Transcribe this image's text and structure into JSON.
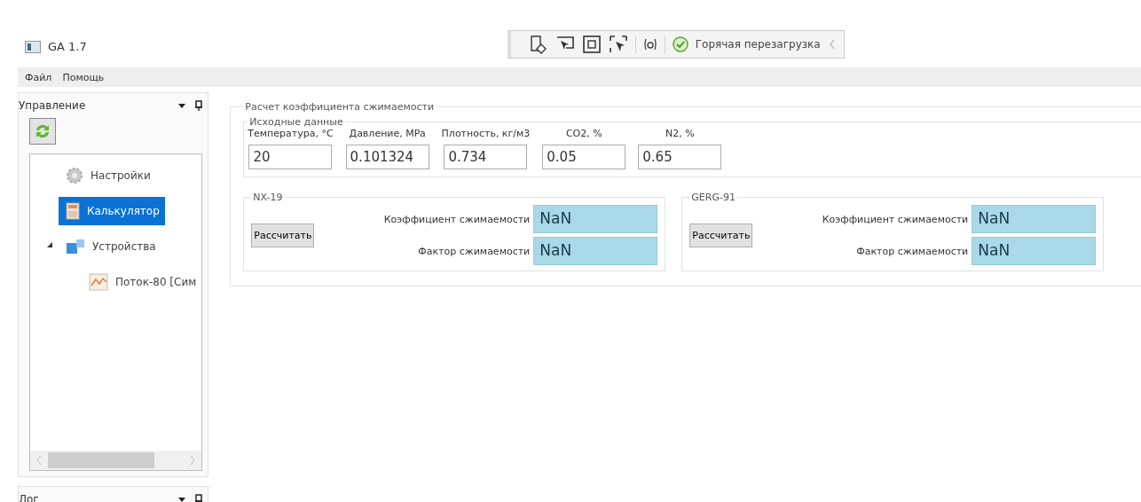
{
  "window": {
    "title": "GA 1.7"
  },
  "toolbar": {
    "status": "Горячая перезагрузка"
  },
  "menu": [
    "Файл",
    "Помощь"
  ],
  "control_panel": {
    "title": "Управление",
    "tree": [
      {
        "kind": "gear",
        "label": "Настройки",
        "selected": false
      },
      {
        "kind": "calculator",
        "label": "Калькулятор",
        "selected": true
      },
      {
        "kind": "devices",
        "label": "Устройства",
        "selected": false,
        "expanded": true,
        "children": [
          {
            "kind": "chart",
            "label": "Поток-80 [Сим",
            "selected": false
          }
        ]
      }
    ]
  },
  "log_panel": {
    "title": "Лог"
  },
  "calc": {
    "title": "Расчет коэффициента сжимаемости",
    "inputs": {
      "title": "Исходные данные",
      "fields": [
        {
          "label": "Температура, °C",
          "value": "20"
        },
        {
          "label": "Давление, MPa",
          "value": "0.101324"
        },
        {
          "label": "Плотность, кг/м3",
          "value": "0.734"
        },
        {
          "label": "CO2, %",
          "value": "0.05"
        },
        {
          "label": "N2, %",
          "value": "0.65"
        }
      ]
    },
    "methods": [
      {
        "title": "NX-19",
        "button": "Рассчитать",
        "results": [
          {
            "label": "Коэффициент сжимаемости",
            "value": "NaN"
          },
          {
            "label": "Фактор сжимаемости",
            "value": "NaN"
          }
        ]
      },
      {
        "title": "GERG-91",
        "button": "Рассчитать",
        "results": [
          {
            "label": "Коэффициент сжимаемости",
            "value": "NaN"
          },
          {
            "label": "Фактор сжимаемости",
            "value": "NaN"
          }
        ]
      }
    ]
  }
}
